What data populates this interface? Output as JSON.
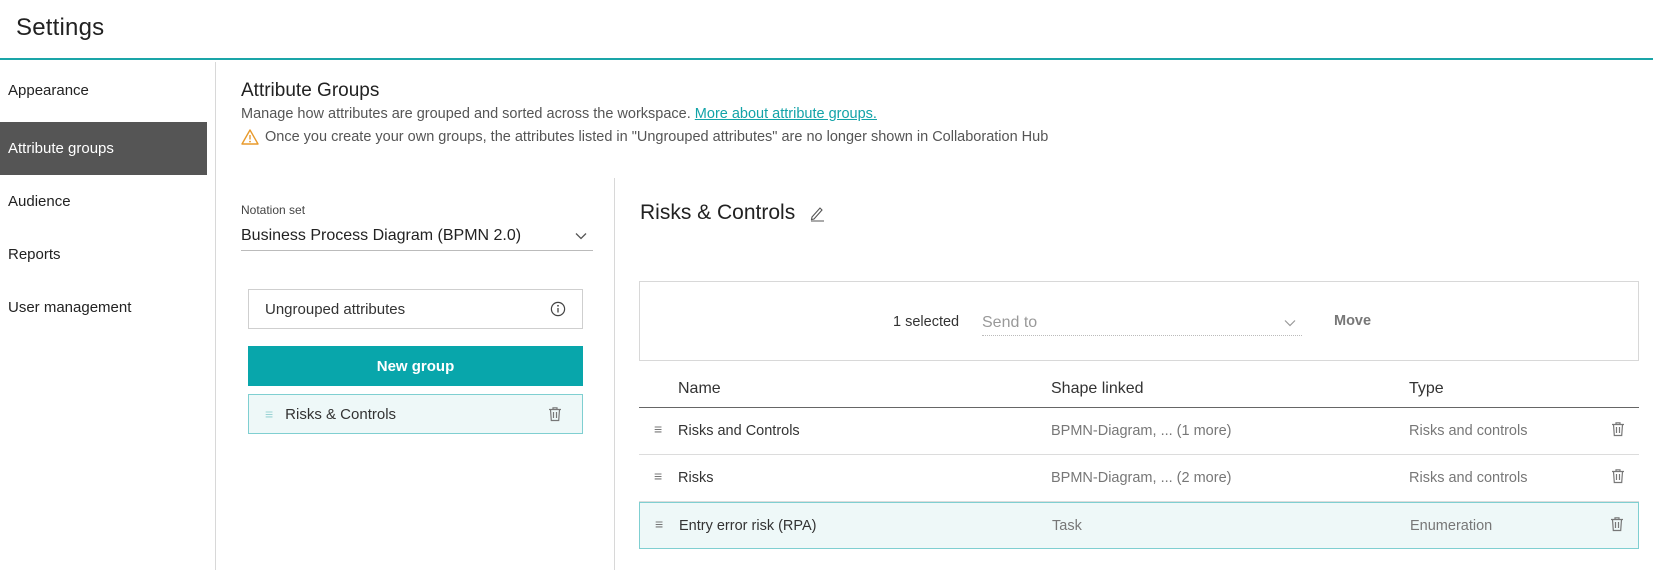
{
  "header": {
    "title": "Settings"
  },
  "sidebar": {
    "items": [
      {
        "label": "Appearance"
      },
      {
        "label": "Attribute groups"
      },
      {
        "label": "Audience"
      },
      {
        "label": "Reports"
      },
      {
        "label": "User management"
      }
    ]
  },
  "attribute_groups": {
    "title": "Attribute Groups",
    "description": "Manage how attributes are grouped and sorted across the workspace.",
    "link_text": "More about attribute groups.",
    "warning": "Once you create your own groups, the attributes listed in \"Ungrouped attributes\" are no longer shown in Collaboration Hub",
    "warning_color": "#e89a2c"
  },
  "left_panel": {
    "notation_label": "Notation set",
    "notation_value": "Business Process Diagram (BPMN 2.0)",
    "ungrouped_label": "Ungrouped attributes",
    "new_group_label": "New group",
    "groups": [
      {
        "label": "Risks & Controls"
      }
    ]
  },
  "right_panel": {
    "title": "Risks & Controls",
    "selected_count": "1 selected",
    "send_to_placeholder": "Send to",
    "move_label": "Move",
    "columns": {
      "name": "Name",
      "shape": "Shape linked",
      "type": "Type"
    },
    "rows": [
      {
        "name": "Risks and Controls",
        "shape": "BPMN-Diagram, ... (1 more)",
        "type": "Risks and controls"
      },
      {
        "name": "Risks",
        "shape": "BPMN-Diagram, ... (2 more)",
        "type": "Risks and controls"
      },
      {
        "name": "Entry error risk (RPA)",
        "shape": "Task",
        "type": "Enumeration"
      }
    ]
  },
  "colors": {
    "accent": "#08a6ab",
    "active_sidebar": "#555555",
    "selected_row_bg": "#eef8f8"
  }
}
